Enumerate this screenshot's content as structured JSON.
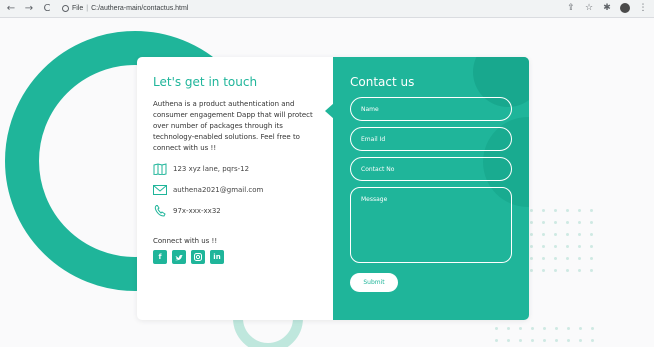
{
  "browser": {
    "file_label": "File",
    "url": "C:/authera-main/contactus.html"
  },
  "contact": {
    "title": "Let's get in touch",
    "description": "Authena is a product authentication and consumer engagement Dapp that will protect over number of packages through its technology-enabled solutions. Feel free to connect with us !!",
    "address": "123 xyz lane, pqrs-12",
    "email": "authena2021@gmail.com",
    "phone": "97x-xxx-xx32",
    "connect_label": "Connect with us !!",
    "social": [
      "f",
      "t",
      "ig",
      "in"
    ]
  },
  "form": {
    "title": "Contact us",
    "name_placeholder": "Name",
    "email_placeholder": "Email Id",
    "phone_placeholder": "Contact No",
    "message_placeholder": "Message",
    "submit_label": "Submit"
  },
  "colors": {
    "accent": "#1fb59a",
    "light_accent": "#bfe7dd"
  }
}
